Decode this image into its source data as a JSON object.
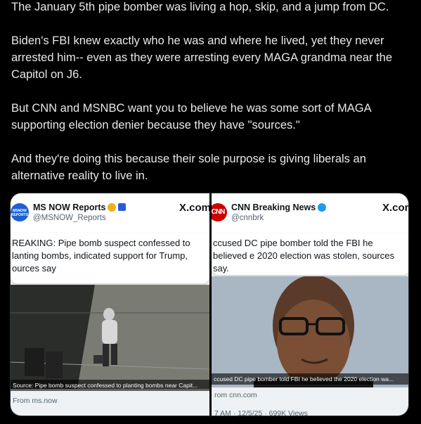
{
  "post": {
    "paragraphs": [
      "The January 5th pipe bomber was living a hop, skip, and a jump from DC.",
      "Biden's FBI knew exactly who he was and where he lived, yet they never arrested him-- even as they were arresting every MAGA grandma near the Capitol on J6.",
      "But CNN and MSNBC want you to believe he was some sort of MAGA supporting election denier because they have \"sources.\"",
      "And they're doing this because their sole purpose is giving liberals an alternative reality to live in."
    ]
  },
  "media": {
    "left": {
      "avatar_text": "MSNOW REPORTS",
      "account_name": "MS NOW Reports",
      "handle": "@MSNOW_Reports",
      "x_logo": "X.com",
      "body": "REAKING: Pipe bomb suspect confessed to lanting bombs, indicated support for Trump, ources say",
      "caption": "Source: Pipe bomb suspect confessed to planting bombs near Capit...",
      "from": "From ms.now",
      "badge_color": "#e8b21c"
    },
    "right": {
      "avatar_text": "CNN",
      "account_name": "CNN Breaking News",
      "handle": "@cnnbrk",
      "x_logo": "X.com",
      "body": "ccused DC pipe bomber told the FBI he believed e 2020 election was stolen, sources say.",
      "caption": "ccused DC pipe bomber told FBI he believed the 2020 election wa...",
      "from": "rom cnn.com",
      "stats": "7 AM · 12/5/25 · 699K Views",
      "badge_color": "#1d9bf0"
    }
  }
}
